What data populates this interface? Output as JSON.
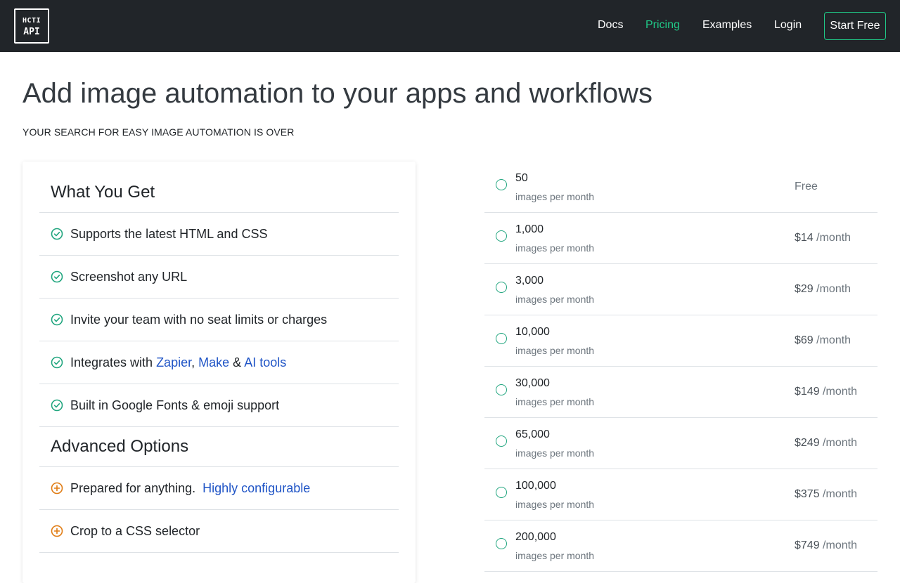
{
  "nav": {
    "logo_line1": "HCTI",
    "logo_line2": "API",
    "links": [
      "Docs",
      "Pricing",
      "Examples",
      "Login"
    ],
    "active": "Pricing",
    "cta": "Start Free"
  },
  "hero": {
    "title": "Add image automation to your apps and workflows",
    "subtitle": "YOUR SEARCH FOR EASY IMAGE AUTOMATION IS OVER"
  },
  "features": {
    "heading": "What You Get",
    "items": [
      "Supports the latest HTML and CSS",
      "Screenshot any URL",
      "Invite your team with no seat limits or charges",
      "Built in Google Fonts & emoji support"
    ],
    "integrates": {
      "prefix": "Integrates with ",
      "zapier": "Zapier",
      "comma": ",",
      "make": "Make",
      "amp": "&",
      "ai": "AI tools"
    },
    "advanced_heading": "Advanced Options",
    "advanced_items": {
      "prepared": "Prepared for anything.",
      "prepared_link": "Highly configurable",
      "crop": "Crop to a CSS selector"
    },
    "icon_check": "check-circle-icon",
    "icon_plus": "plus-circle-icon",
    "check_color": "#20a57e",
    "plus_color": "#e07b12"
  },
  "plans": {
    "unit_label": "images per month",
    "per": "/month",
    "items": [
      {
        "qty": "50",
        "price": "Free"
      },
      {
        "qty": "1,000",
        "price": "$14"
      },
      {
        "qty": "3,000",
        "price": "$29"
      },
      {
        "qty": "10,000",
        "price": "$69"
      },
      {
        "qty": "30,000",
        "price": "$149"
      },
      {
        "qty": "65,000",
        "price": "$249"
      },
      {
        "qty": "100,000",
        "price": "$375"
      },
      {
        "qty": "200,000",
        "price": "$749"
      }
    ]
  },
  "colors": {
    "navbar": "#212529",
    "accent": "#20c987",
    "link": "#1f54c6"
  }
}
